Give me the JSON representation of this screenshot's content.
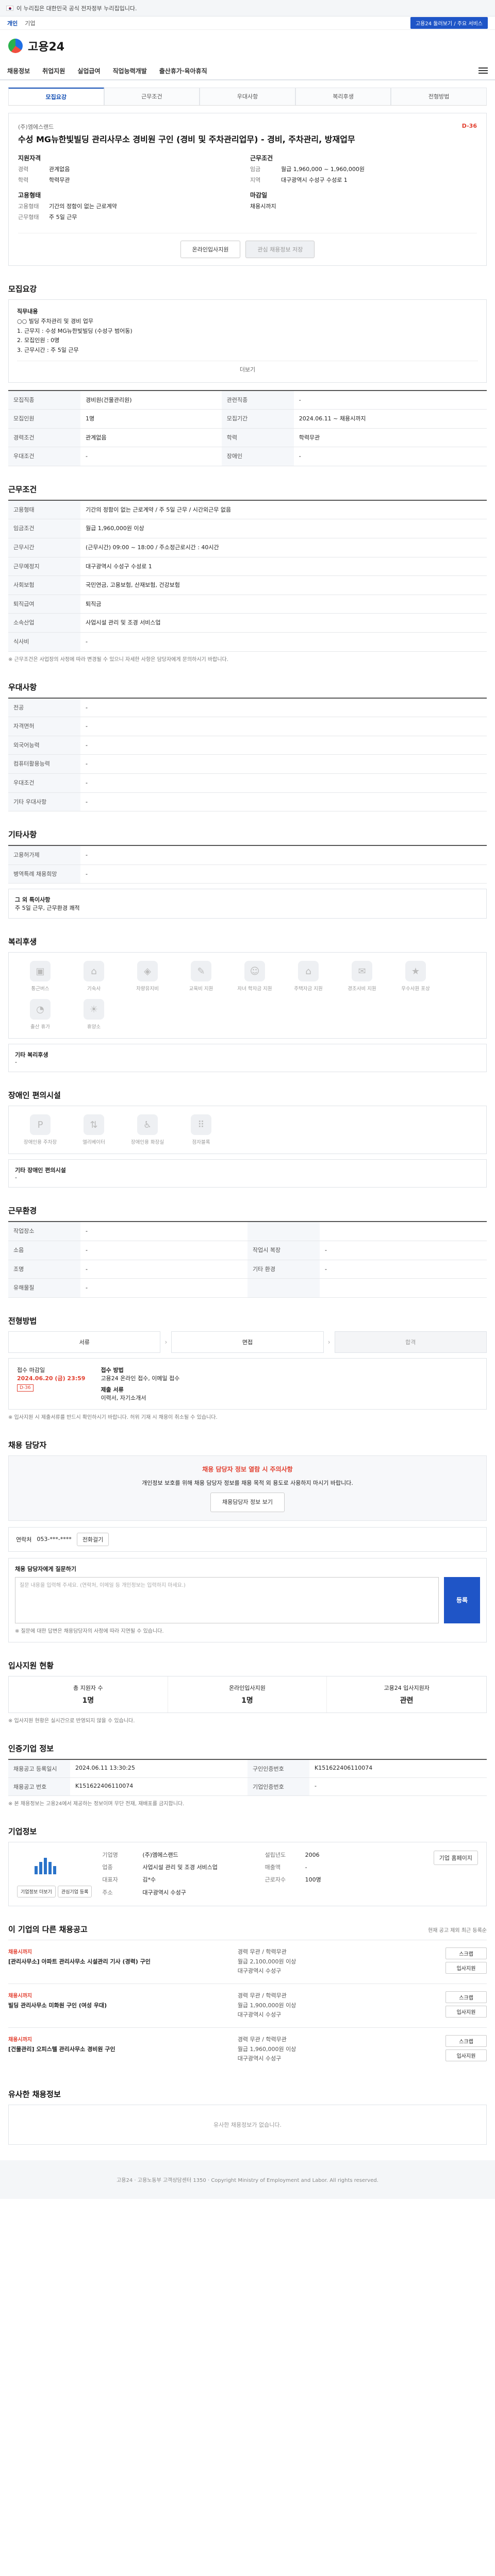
{
  "gov": {
    "text": "이 누리집은 대한민국 공식 전자정부 누리집입니다."
  },
  "topstrip": {
    "links": [
      "개인",
      "기업"
    ],
    "right": "고용24 둘러보기 / 주요 서비스"
  },
  "header": {
    "logo": "고용24"
  },
  "gnb": [
    "채용정보",
    "취업지원",
    "실업급여",
    "직업능력개발",
    "출산휴가·육아휴직"
  ],
  "subtabs": [
    "모집요강",
    "근무조건",
    "우대사항",
    "복리후생",
    "전형방법"
  ],
  "job": {
    "company": "(주)엠에스랜드",
    "title": "수성 MG뉴한빛빌딩 관리사무소 경비원 구인 (경비 및 주차관리업무) - 경비, 주차관리, 방재업무",
    "dday": "D-36",
    "left_head": "지원자격",
    "right_head": "근무조건",
    "left": [
      {
        "k": "경력",
        "v": "관계없음"
      },
      {
        "k": "학력",
        "v": "학력무관"
      }
    ],
    "right": [
      {
        "k": "임금",
        "v": "월급 1,960,000 ~ 1,960,000원"
      },
      {
        "k": "지역",
        "v": "대구광역시 수성구 수성로 1"
      }
    ],
    "apply_head": "고용형태",
    "apply": [
      {
        "k": "고용형태",
        "v": "기간의 정함이 없는 근로계약"
      },
      {
        "k": "근무형태",
        "v": "주 5일 근무"
      }
    ],
    "btn_apply": "온라인입사지원",
    "btn_scrap": "관심 채용정보 저장",
    "closing_head": "마감일",
    "closing": "채용시까지"
  },
  "recruit": {
    "title": "모집요강",
    "job_title_label": "직무내용",
    "lines": [
      "○○ 빌딩 주차관리 및 경비 업무",
      "1. 근무지 : 수성 MG뉴한빛빌딩 (수성구 범어동)",
      "2. 모집인원 : 0명",
      "3. 근무시간 : 주 5일 근무"
    ],
    "more": "더보기"
  },
  "detail_rows": [
    {
      "k": "모집직종",
      "v": "경비원(건물관리원)",
      "k2": "관련직종",
      "v2": "-"
    },
    {
      "k": "모집인원",
      "v": "1명",
      "k2": "모집기간",
      "v2": "2024.06.11 ~ 채용시까지"
    },
    {
      "k": "경력조건",
      "v": "관계없음",
      "k2": "학력",
      "v2": "학력무관"
    },
    {
      "k": "우대조건",
      "v": "-",
      "k2": "장애인",
      "v2": "-"
    }
  ],
  "work": {
    "title": "근무조건",
    "rows": [
      {
        "k": "고용형태",
        "v": "기간의 정함이 없는 근로계약 / 주 5일 근무 / 시간외근무 없음"
      },
      {
        "k": "임금조건",
        "v": "월급 1,960,000원 이상"
      },
      {
        "k": "근무시간",
        "v": "(근무시간) 09:00 ~ 18:00 / 주소정근로시간 : 40시간"
      },
      {
        "k": "근무예정지",
        "v": "대구광역시 수성구 수성로 1"
      },
      {
        "k": "사회보험",
        "v": "국민연금, 고용보험, 산재보험, 건강보험"
      },
      {
        "k": "퇴직급여",
        "v": "퇴직금"
      },
      {
        "k": "소속산업",
        "v": "사업시설 관리 및 조경 서비스업"
      },
      {
        "k": "식사비",
        "v": "-"
      }
    ],
    "note": "※ 근무조건은 사업장의 사정에 따라 변경될 수 있으니 자세한 사항은 담당자에게 문의하시기 바랍니다."
  },
  "pref": {
    "title": "우대사항",
    "rows": [
      {
        "k": "전공",
        "v": "-"
      },
      {
        "k": "자격면허",
        "v": "-"
      },
      {
        "k": "외국어능력",
        "v": "-"
      },
      {
        "k": "컴퓨터활용능력",
        "v": "-"
      },
      {
        "k": "우대조건",
        "v": "-"
      },
      {
        "k": "기타 우대사항",
        "v": "-"
      }
    ]
  },
  "etc": {
    "title": "기타사항",
    "rows": [
      {
        "k": "고용허가제",
        "v": "-"
      },
      {
        "k": "병역특례 채용희망",
        "v": "-"
      }
    ],
    "extra_title": "그 외 특이사항",
    "extra": "주 5일 근무, 근무환경 쾌적"
  },
  "welfare": {
    "title": "복리후생",
    "icons": [
      "통근버스",
      "기숙사",
      "차량유지비",
      "교육비 지원",
      "자녀 학자금 지원",
      "주택자금 지원",
      "경조사비 지원",
      "우수사원 포상",
      "출산 휴가",
      "휴양소"
    ],
    "other_label": "기타 복리후생",
    "other": "-"
  },
  "disability": {
    "title": "장애인 편의시설",
    "icons": [
      "장애인용 주차장",
      "엘리베이터",
      "장애인용 화장실",
      "점자블록"
    ],
    "other_label": "기타 장애인 편의시설",
    "other": "-"
  },
  "workplace": {
    "title": "근무환경",
    "rows": [
      {
        "k": "작업장소",
        "v": "-",
        "k2": "",
        "v2": ""
      },
      {
        "k": "소음",
        "v": "-",
        "k2": "작업시 복장",
        "v2": "-"
      },
      {
        "k": "조명",
        "v": "-",
        "k2": "기타 환경",
        "v2": "-"
      },
      {
        "k": "유해물질",
        "v": "-",
        "k2": "",
        "v2": ""
      }
    ]
  },
  "process": {
    "title": "전형방법",
    "steps": [
      "서류",
      "면접",
      "합격"
    ],
    "apply_method_label": "접수 방법",
    "apply_method": "고용24 온라인 접수, 이메일 접수",
    "deadline_label": "접수 마감일",
    "deadline": "2024.06.20 (금) 23:59",
    "tag": "D-36",
    "docs_label": "제출 서류",
    "docs": "이력서, 자기소개서",
    "note": "※ 입사지원 시 제출서류를 반드시 확인하시기 바랍니다. 허위 기재 시 채용이 취소될 수 있습니다."
  },
  "contact": {
    "title": "채용 담당자",
    "warn_head": "채용 담당자 정보 열람 시 주의사항",
    "warn": "개인정보 보호를 위해 채용 담당자 정보를 채용 목적 외 용도로 사용하지 마시기 바랍니다.",
    "btn": "채용담당자 정보 보기",
    "phone_label": "연락처",
    "phone": "053-***-****",
    "phone_btn": "전화걸기",
    "q_title": "채용 담당자에게 질문하기",
    "q_placeholder": "질문 내용을 입력해 주세요. (연락처, 이메일 등 개인정보는 입력하지 마세요.)",
    "q_btn": "등록",
    "q_note": "※ 질문에 대한 답변은 채용담당자의 사정에 따라 지연될 수 있습니다."
  },
  "status": {
    "title": "입사지원 현황",
    "items": [
      {
        "label": "총 지원자 수",
        "v": "1명"
      },
      {
        "label": "온라인입사지원",
        "v": "1명"
      },
      {
        "label": "고용24 입사지원자",
        "v": "관련"
      }
    ],
    "note": "※ 입사지원 현황은 실시간으로 반영되지 않을 수 있습니다."
  },
  "meta": {
    "title": "인증기업 정보",
    "rows": [
      {
        "k": "채용공고 등록일시",
        "v": "2024.06.11 13:30:25",
        "k2": "구인인증번호",
        "v2": "K151622406110074"
      },
      {
        "k": "채용공고 번호",
        "v": "K151622406110074",
        "k2": "기업인증번호",
        "v2": "-"
      }
    ],
    "note": "※ 본 채용정보는 고용24에서 제공하는 정보이며 무단 전재, 재배포를 금지합니다."
  },
  "corp": {
    "title": "기업정보",
    "rows": [
      {
        "k": "기업명",
        "v": "(주)엠에스랜드",
        "k2": "설립년도",
        "v2": "2006"
      },
      {
        "k": "업종",
        "v": "사업시설 관리 및 조경 서비스업",
        "k2": "매출액",
        "v2": "-"
      },
      {
        "k": "대표자",
        "v": "김*수",
        "k2": "근로자수",
        "v2": "100명"
      },
      {
        "k": "주소",
        "v": "대구광역시 수성구",
        "k2": "",
        "v2": ""
      }
    ],
    "btn1": "기업정보 더보기",
    "btn2": "관심기업 등록",
    "btn3": "기업 홈페이지"
  },
  "others": {
    "title": "이 기업의 다른 채용공고",
    "sort": "현재 공고 제외 최근 등록순",
    "jobs": [
      {
        "tag": "채용시까지",
        "name": "[관리사무소] 아파트 관리사무소 시설관리 기사 (경력) 구인",
        "m1": "경력 무관 / 학력무관",
        "m2": "월급 2,100,000원 이상",
        "m3": "대구광역시 수성구",
        "r": [
          "스크랩",
          "입사지원"
        ]
      },
      {
        "tag": "채용시까지",
        "name": "빌딩 관리사무소 미화원 구인 (여성 우대)",
        "m1": "경력 무관 / 학력무관",
        "m2": "월급 1,900,000원 이상",
        "m3": "대구광역시 수성구",
        "r": [
          "스크랩",
          "입사지원"
        ]
      },
      {
        "tag": "채용시까지",
        "name": "[건물관리] 오피스텔 관리사무소 경비원 구인",
        "m1": "경력 무관 / 학력무관",
        "m2": "월급 1,960,000원 이상",
        "m3": "대구광역시 수성구",
        "r": [
          "스크랩",
          "입사지원"
        ]
      }
    ]
  },
  "similar": {
    "title": "유사한 채용정보",
    "empty": "유사한 채용정보가 없습니다."
  },
  "footer": {
    "text": "고용24 · 고용노동부 고객상담센터 1350 · Copyright Ministry of Employment and Labor. All rights reserved."
  }
}
